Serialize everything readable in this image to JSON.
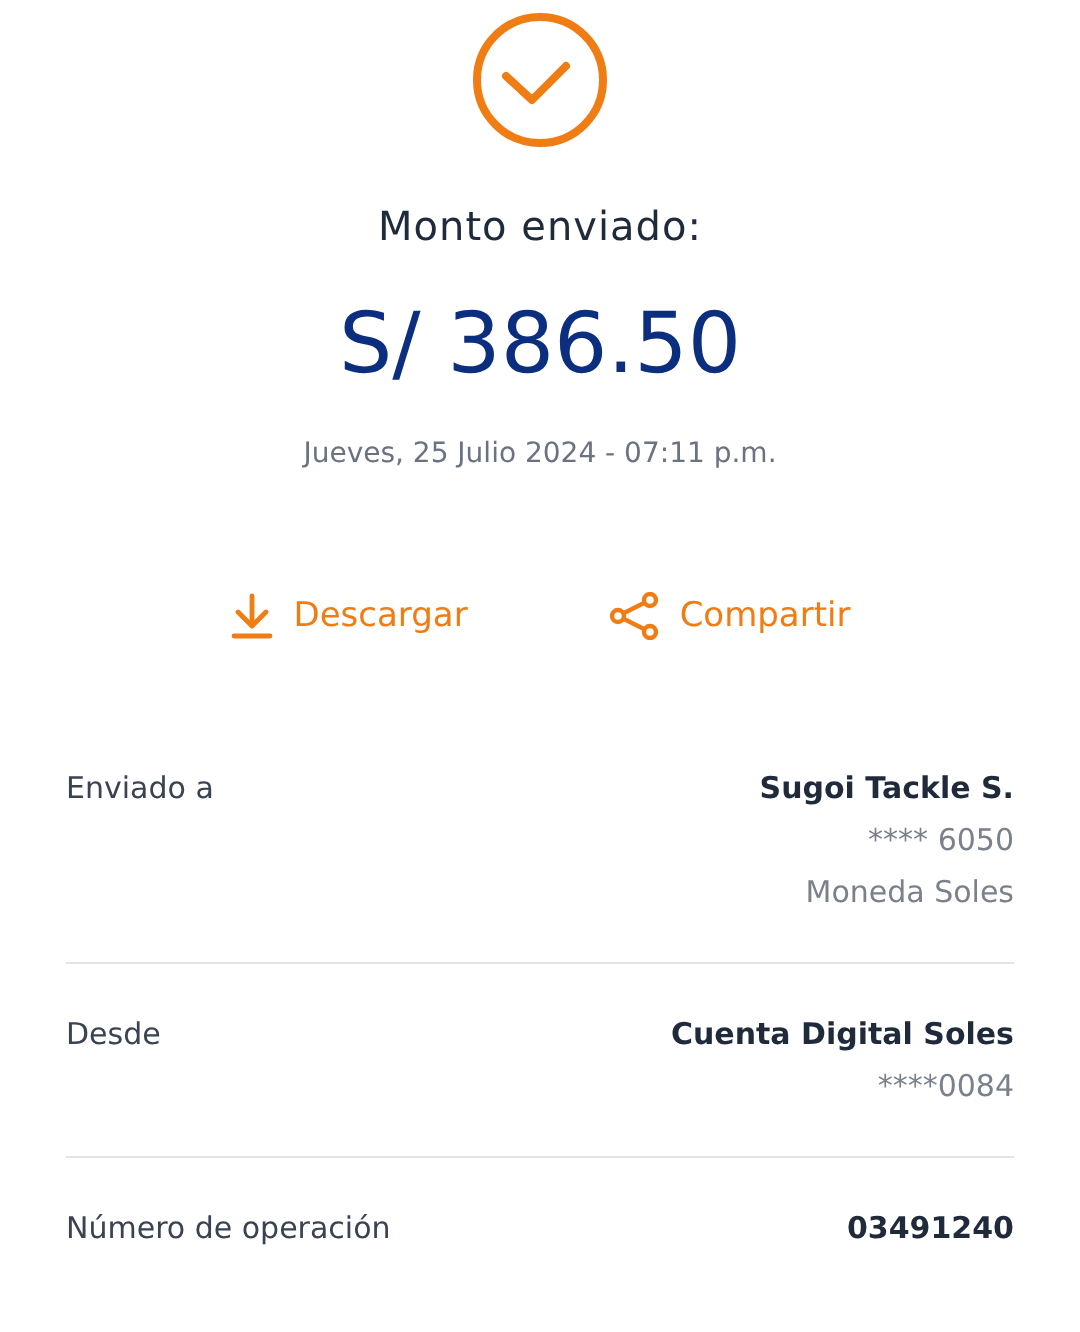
{
  "title": "Monto enviado:",
  "amount": "S/ 386.50",
  "datetime": "Jueves, 25 Julio 2024 - 07:11 p.m.",
  "actions": [
    {
      "kind": "download",
      "label": "Descargar"
    },
    {
      "kind": "share",
      "label": "Compartir"
    }
  ],
  "details": [
    {
      "label": "Enviado a",
      "lines": [
        {
          "kind": "primary",
          "text": "Sugoi Tackle S."
        },
        {
          "kind": "secondary",
          "text": "**** 6050"
        },
        {
          "kind": "secondary",
          "text": "Moneda Soles"
        }
      ]
    },
    {
      "label": "Desde",
      "lines": [
        {
          "kind": "primary",
          "text": "Cuenta Digital Soles"
        },
        {
          "kind": "secondary",
          "text": "****0084"
        }
      ]
    },
    {
      "label": "Número de operación",
      "lines": [
        {
          "kind": "primary",
          "text": "03491240"
        }
      ]
    }
  ]
}
